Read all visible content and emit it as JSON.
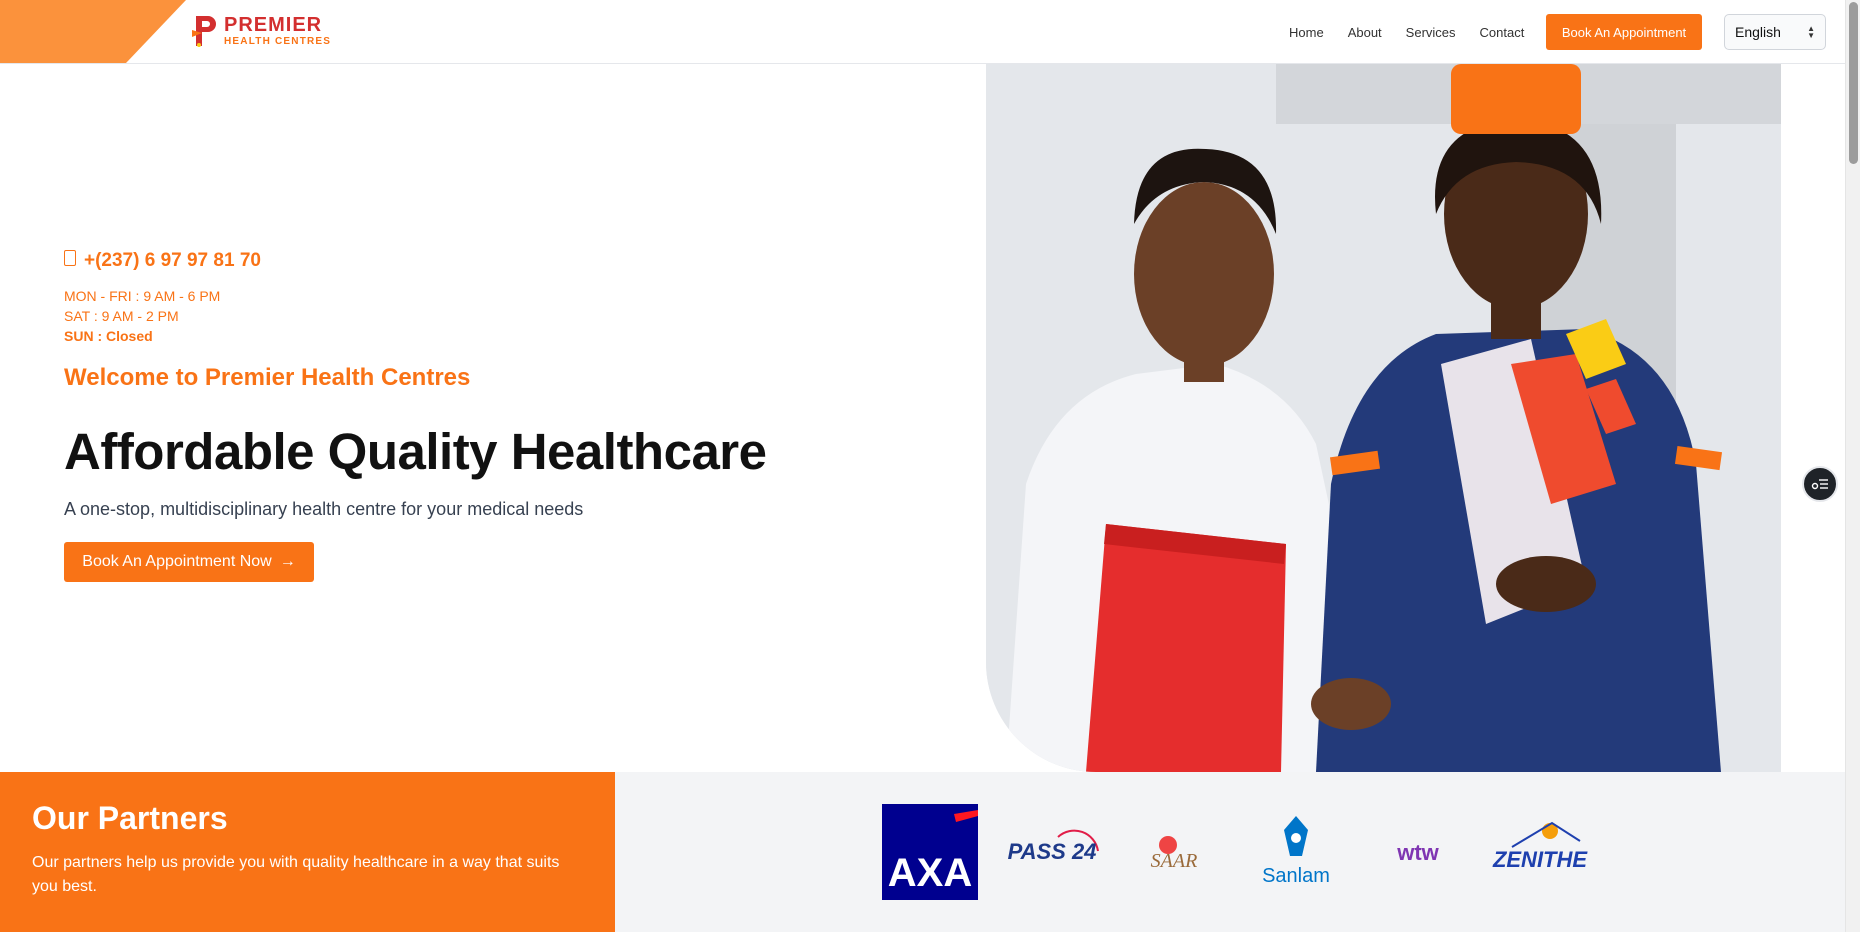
{
  "header": {
    "logo": {
      "line1": "PREMIER",
      "line2": "HEALTH CENTRES"
    },
    "nav": [
      {
        "label": "Home"
      },
      {
        "label": "About"
      },
      {
        "label": "Services"
      },
      {
        "label": "Contact"
      }
    ],
    "book_button": "Book An Appointment",
    "language": "English"
  },
  "hero": {
    "phone": "+(237) 6 97 97 81 70",
    "hours": {
      "weekdays": "MON - FRI : 9 AM - 6 PM",
      "saturday": "SAT : 9 AM - 2 PM",
      "sunday": "SUN : Closed"
    },
    "welcome": "Welcome to Premier Health Centres",
    "headline": "Affordable Quality Healthcare",
    "subline": "A one-stop, multidisciplinary health centre for your medical needs",
    "cta_label": "Book An Appointment Now",
    "cta_arrow": "→"
  },
  "partners": {
    "title": "Our Partners",
    "description": "Our partners help us provide you with quality healthcare in a way that suits you best.",
    "logos": [
      {
        "name": "AXA",
        "text": "AXA"
      },
      {
        "name": "PASS 24",
        "text": "PASS 24"
      },
      {
        "name": "SAAR",
        "text": "SAAR"
      },
      {
        "name": "Sanlam",
        "text": "Sanlam"
      },
      {
        "name": "wtw",
        "text": "wtw"
      },
      {
        "name": "Zenithe Insurance",
        "text": "ZENITHE"
      }
    ]
  },
  "colors": {
    "brand_orange": "#f97316",
    "brand_red": "#d32f2f"
  }
}
